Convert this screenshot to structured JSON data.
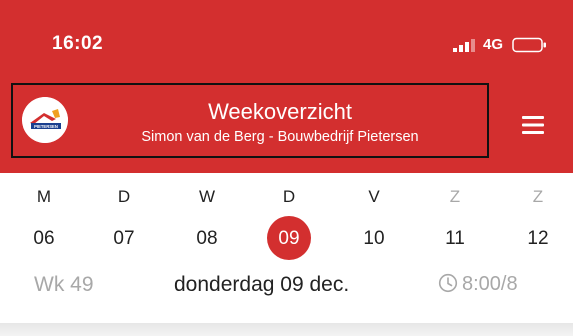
{
  "status_bar": {
    "time": "16:02",
    "network": "4G"
  },
  "header": {
    "title": "Weekoverzicht",
    "subtitle": "Simon van de Berg - Bouwbedrijf Pietersen",
    "logo_text": "PIETERSEN",
    "menu_icon": "hamburger-menu-icon"
  },
  "week": {
    "days": [
      {
        "letter": "M",
        "number": "06",
        "selected": false,
        "weekend": false
      },
      {
        "letter": "D",
        "number": "07",
        "selected": false,
        "weekend": false
      },
      {
        "letter": "W",
        "number": "08",
        "selected": false,
        "weekend": false
      },
      {
        "letter": "D",
        "number": "09",
        "selected": true,
        "weekend": false
      },
      {
        "letter": "V",
        "number": "10",
        "selected": false,
        "weekend": false
      },
      {
        "letter": "Z",
        "number": "11",
        "selected": false,
        "weekend": true
      },
      {
        "letter": "Z",
        "number": "12",
        "selected": false,
        "weekend": true
      }
    ],
    "week_label": "Wk 49",
    "selected_date": "donderdag 09 dec.",
    "hours": "8:00/8"
  },
  "colors": {
    "brand_red": "#d32f2f",
    "muted": "#a8a8a8"
  }
}
